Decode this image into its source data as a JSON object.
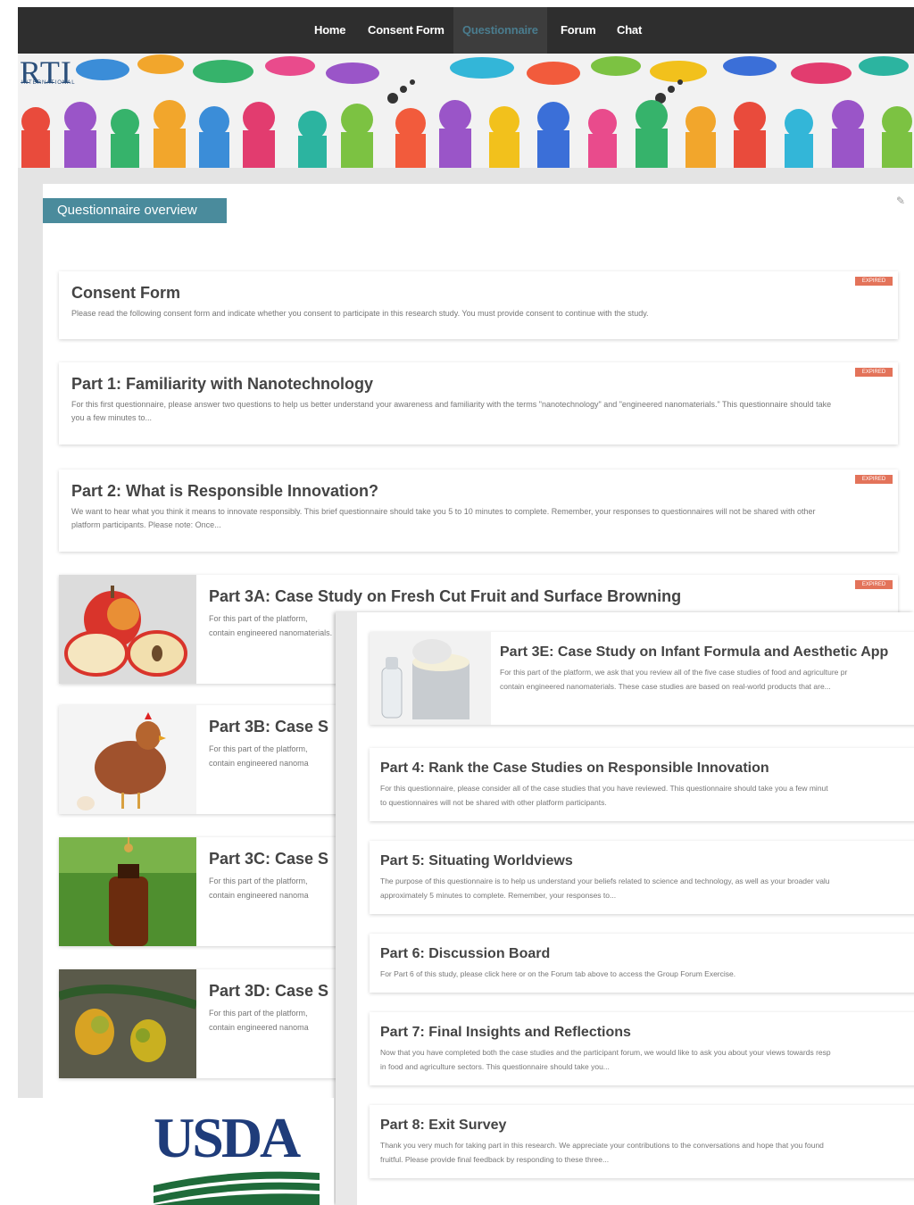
{
  "nav": {
    "items": [
      {
        "label": "Home"
      },
      {
        "label": "Consent Form"
      },
      {
        "label": "Questionnaire"
      },
      {
        "label": "Forum"
      },
      {
        "label": "Chat"
      }
    ]
  },
  "banner": {
    "logo_text": "RTI",
    "logo_sub": "INTERNATIONAL"
  },
  "panel": {
    "tab_label": "Questionnaire overview"
  },
  "badge_label": "EXPIRED",
  "back_cards": [
    {
      "title": "Consent Form",
      "desc": "Please read the following consent form and indicate whether you consent to participate in this research study. You must provide consent to continue with the study."
    },
    {
      "title": "Part 1: Familiarity with Nanotechnology",
      "desc": "For this first questionnaire, please answer two questions to help us better understand your awareness and familiarity with the terms \"nanotechnology\" and \"engineered nanomaterials.\" This questionnaire should take you a few minutes to..."
    },
    {
      "title": "Part 2: What is Responsible Innovation?",
      "desc": "We want to hear what you think it means to innovate responsibly. This brief questionnaire should take you 5 to 10 minutes to complete. Remember, your responses to questionnaires will not be shared with other platform participants. Please note: Once..."
    }
  ],
  "thumb_cards": [
    {
      "title": "Part 3A: Case Study on Fresh Cut Fruit and Surface Browning",
      "desc1": "For this part of the platform,",
      "desc2": "contain engineered nanomaterials."
    },
    {
      "title": "Part 3B: Case S",
      "desc1": "For this part of the platform,",
      "desc2": "contain engineered nanoma"
    },
    {
      "title": "Part 3C: Case S",
      "desc1": "For this part of the platform,",
      "desc2": "contain engineered nanoma"
    },
    {
      "title": "Part 3D: Case S",
      "desc1": "For this part of the platform,",
      "desc2": "contain engineered nanoma"
    }
  ],
  "front_cards": [
    {
      "title": "Part 3E: Case Study on Infant Formula and Aesthetic App",
      "desc1": "For this part of the platform, we ask that you review all of the five case studies of food and agriculture pr",
      "desc2": "contain engineered nanomaterials. These case studies are based on real-world products that are..."
    },
    {
      "title": "Part 4: Rank the Case Studies on Responsible Innovation",
      "desc1": "For this questionnaire, please consider all of the case studies that you have reviewed. This questionnaire should take you a few minut",
      "desc2": "to questionnaires will not be shared with other platform participants."
    },
    {
      "title": "Part 5: Situating Worldviews",
      "desc1": "The purpose of this questionnaire is to help us understand your beliefs related to science and technology, as well as your broader valu",
      "desc2": "approximately 5 minutes to complete. Remember, your responses to..."
    },
    {
      "title": "Part 6: Discussion Board",
      "desc1": "For Part 6 of this study, please click here or on the Forum tab above to access the Group Forum Exercise.",
      "desc2": ""
    },
    {
      "title": "Part 7: Final Insights and Reflections",
      "desc1": "Now that you have completed both the case studies and the participant forum, we would like to ask you about your views towards resp",
      "desc2": "in food and agriculture sectors. This questionnaire should take you..."
    },
    {
      "title": "Part 8: Exit Survey",
      "desc1": "Thank you very much for taking part in this research. We appreciate your contributions to the conversations and hope that you found",
      "desc2": "fruitful. Please provide final feedback by responding to these three..."
    }
  ],
  "usda": {
    "text": "USDA"
  }
}
